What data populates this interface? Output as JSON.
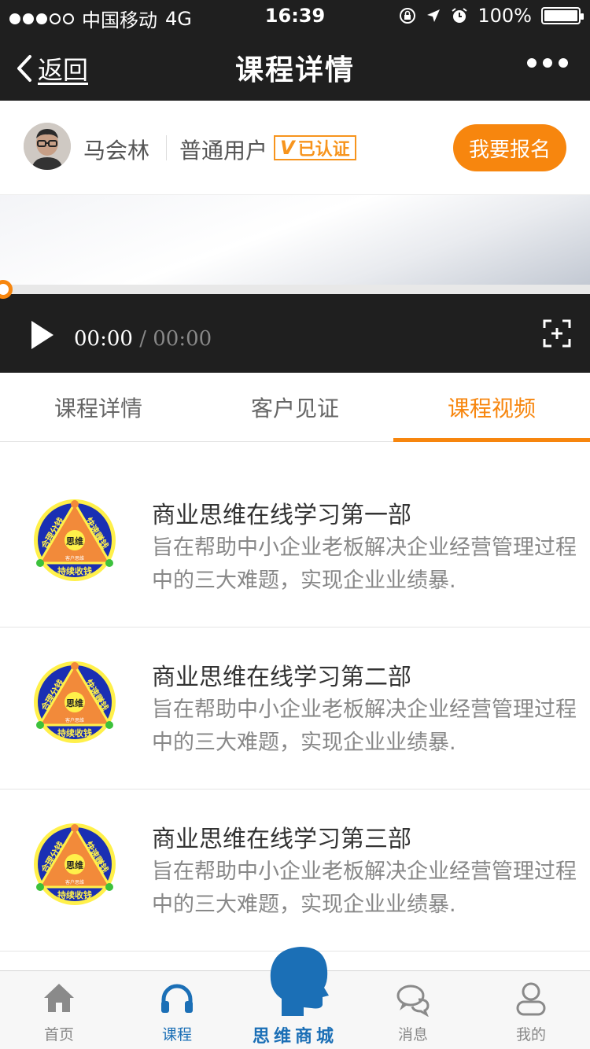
{
  "status_bar": {
    "carrier": "中国移动",
    "network": "4G",
    "time": "16:39",
    "battery": "100%",
    "battery_level": 1.0
  },
  "nav": {
    "back_label": "返回",
    "title": "课程详情"
  },
  "user": {
    "name": "马会林",
    "type": "普通用户",
    "verified_mark": "V",
    "verified_label": "已认证",
    "enroll_label": "我要报名"
  },
  "video": {
    "current_time": "00:00",
    "separator": "/",
    "duration": "00:00",
    "progress": 0
  },
  "tabs": [
    {
      "label": "课程详情",
      "active": false
    },
    {
      "label": "客户见证",
      "active": false
    },
    {
      "label": "课程视频",
      "active": true
    }
  ],
  "courses": [
    {
      "title": "商业思维在线学习第一部",
      "desc": "旨在帮助中小企业老板解决企业经营管理过程中的三大难题，实现企业业绩暴."
    },
    {
      "title": "商业思维在线学习第二部",
      "desc": "旨在帮助中小企业老板解决企业经营管理过程中的三大难题，实现企业业绩暴."
    },
    {
      "title": "商业思维在线学习第三部",
      "desc": "旨在帮助中小企业老板解决企业经营管理过程中的三大难题，实现企业业绩暴."
    }
  ],
  "course_logo": {
    "left": "合理分钱",
    "right": "快速赚钱",
    "bottom": "持续收钱",
    "center": "思维",
    "sub_left": "团队思维",
    "sub_right": "营销思维",
    "sub_bottom": "客户思维"
  },
  "tabbar": {
    "home": "首页",
    "course": "课程",
    "center": "思维商城",
    "messages": "消息",
    "mine": "我的"
  },
  "colors": {
    "accent": "#f7860e",
    "nav_bg": "#1f1f1f",
    "tabbar_active": "#1b6fb6"
  }
}
